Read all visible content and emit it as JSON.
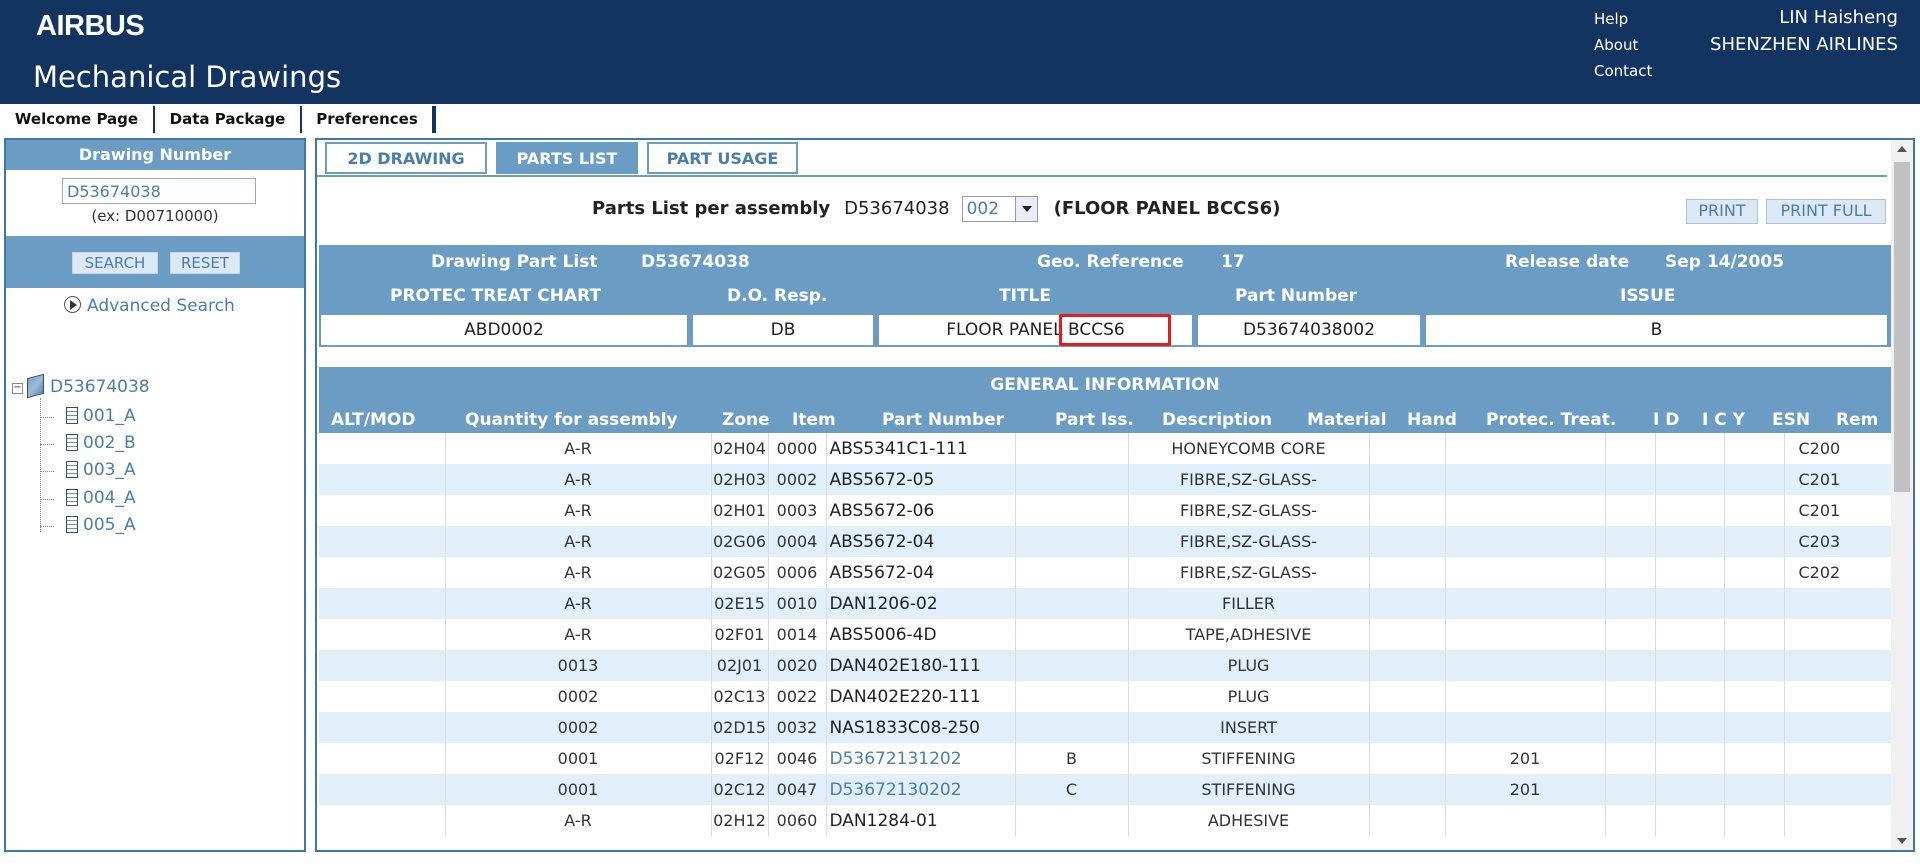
{
  "header": {
    "logo": "AIRBUS",
    "app_title": "Mechanical Drawings",
    "links": [
      "Help",
      "About",
      "Contact"
    ],
    "user_name": "LIN Haisheng",
    "airline": "SHENZHEN AIRLINES"
  },
  "nav": {
    "items": [
      "Welcome Page",
      "Data Package",
      "Preferences"
    ]
  },
  "left_panel": {
    "title": "Drawing Number",
    "search_value": "D53674038",
    "example": "(ex: D00710000)",
    "search_button": "SEARCH",
    "reset_button": "RESET",
    "advanced_search": "Advanced Search",
    "tree_root": "D53674038",
    "tree_children": [
      "001_A",
      "002_B",
      "003_A",
      "004_A",
      "005_A"
    ]
  },
  "tabs": [
    "2D DRAWING",
    "PARTS LIST",
    "PART USAGE"
  ],
  "parts_list": {
    "label": "Parts List per assembly",
    "assembly": "D53674038",
    "variant": "002",
    "assembly_title": "(FLOOR PANEL BCCS6)",
    "print": "PRINT",
    "print_full": "PRINT FULL"
  },
  "drawing_info": {
    "drawing_part_list_label": "Drawing Part List",
    "drawing_part_list_value": "D53674038",
    "geo_reference_label": "Geo. Reference",
    "geo_reference_value": "17",
    "release_date_label": "Release date",
    "release_date_value": "Sep 14/2005",
    "headers": [
      "PROTEC TREAT CHART",
      "D.O. Resp.",
      "TITLE",
      "Part Number",
      "ISSUE"
    ],
    "values": [
      "ABD0002",
      "DB",
      "FLOOR PANEL BCCS6",
      "D53674038002",
      "B"
    ]
  },
  "general_info": {
    "title": "GENERAL INFORMATION",
    "columns": [
      "ALT/MOD",
      "Quantity for assembly",
      "Zone",
      "Item",
      "Part Number",
      "Part Iss.",
      "Description",
      "Material",
      "Hand",
      "Protec. Treat.",
      "I D",
      "I C Y",
      "ESN",
      "Rem"
    ],
    "rows": [
      {
        "alt": "",
        "qty": "A-R",
        "zone": "02H04",
        "item": "0000",
        "pn": "ABS5341C1-111",
        "iss": "",
        "desc": "HONEYCOMB CORE",
        "hand": "",
        "prot": "",
        "id": "",
        "icy": "",
        "esn": "",
        "rem": "C200",
        "link": false
      },
      {
        "alt": "",
        "qty": "A-R",
        "zone": "02H03",
        "item": "0002",
        "pn": "ABS5672-05",
        "iss": "",
        "desc": "FIBRE,SZ-GLASS-",
        "hand": "",
        "prot": "",
        "id": "",
        "icy": "",
        "esn": "",
        "rem": "C201",
        "link": false
      },
      {
        "alt": "",
        "qty": "A-R",
        "zone": "02H01",
        "item": "0003",
        "pn": "ABS5672-06",
        "iss": "",
        "desc": "FIBRE,SZ-GLASS-",
        "hand": "",
        "prot": "",
        "id": "",
        "icy": "",
        "esn": "",
        "rem": "C201",
        "link": false
      },
      {
        "alt": "",
        "qty": "A-R",
        "zone": "02G06",
        "item": "0004",
        "pn": "ABS5672-04",
        "iss": "",
        "desc": "FIBRE,SZ-GLASS-",
        "hand": "",
        "prot": "",
        "id": "",
        "icy": "",
        "esn": "",
        "rem": "C203",
        "link": false
      },
      {
        "alt": "",
        "qty": "A-R",
        "zone": "02G05",
        "item": "0006",
        "pn": "ABS5672-04",
        "iss": "",
        "desc": "FIBRE,SZ-GLASS-",
        "hand": "",
        "prot": "",
        "id": "",
        "icy": "",
        "esn": "",
        "rem": "C202",
        "link": false
      },
      {
        "alt": "",
        "qty": "A-R",
        "zone": "02E15",
        "item": "0010",
        "pn": "DAN1206-02",
        "iss": "",
        "desc": "FILLER",
        "hand": "",
        "prot": "",
        "id": "",
        "icy": "",
        "esn": "",
        "rem": "",
        "link": false
      },
      {
        "alt": "",
        "qty": "A-R",
        "zone": "02F01",
        "item": "0014",
        "pn": "ABS5006-4D",
        "iss": "",
        "desc": "TAPE,ADHESIVE",
        "hand": "",
        "prot": "",
        "id": "",
        "icy": "",
        "esn": "",
        "rem": "",
        "link": false
      },
      {
        "alt": "",
        "qty": "0013",
        "zone": "02J01",
        "item": "0020",
        "pn": "DAN402E180-111",
        "iss": "",
        "desc": "PLUG",
        "hand": "",
        "prot": "",
        "id": "",
        "icy": "",
        "esn": "",
        "rem": "",
        "link": false
      },
      {
        "alt": "",
        "qty": "0002",
        "zone": "02C13",
        "item": "0022",
        "pn": "DAN402E220-111",
        "iss": "",
        "desc": "PLUG",
        "hand": "",
        "prot": "",
        "id": "",
        "icy": "",
        "esn": "",
        "rem": "",
        "link": false
      },
      {
        "alt": "",
        "qty": "0002",
        "zone": "02D15",
        "item": "0032",
        "pn": "NAS1833C08-250",
        "iss": "",
        "desc": "INSERT",
        "hand": "",
        "prot": "",
        "id": "",
        "icy": "",
        "esn": "",
        "rem": "",
        "link": false
      },
      {
        "alt": "",
        "qty": "0001",
        "zone": "02F12",
        "item": "0046",
        "pn": "D53672131202",
        "iss": "B",
        "desc": "STIFFENING",
        "hand": "",
        "prot": "201",
        "id": "",
        "icy": "",
        "esn": "",
        "rem": "",
        "link": true
      },
      {
        "alt": "",
        "qty": "0001",
        "zone": "02C12",
        "item": "0047",
        "pn": "D53672130202",
        "iss": "C",
        "desc": "STIFFENING",
        "hand": "",
        "prot": "201",
        "id": "",
        "icy": "",
        "esn": "",
        "rem": "",
        "link": true
      },
      {
        "alt": "",
        "qty": "A-R",
        "zone": "02H12",
        "item": "0060",
        "pn": "DAN1284-01",
        "iss": "",
        "desc": "ADHESIVE",
        "hand": "",
        "prot": "",
        "id": "",
        "icy": "",
        "esn": "",
        "rem": "",
        "link": false
      }
    ]
  },
  "colors": {
    "header_bg": "#133461",
    "accent": "#6a9cc4",
    "link": "#4a7eaa",
    "row_alt": "#e0effa",
    "highlight": "#e01e1e"
  }
}
